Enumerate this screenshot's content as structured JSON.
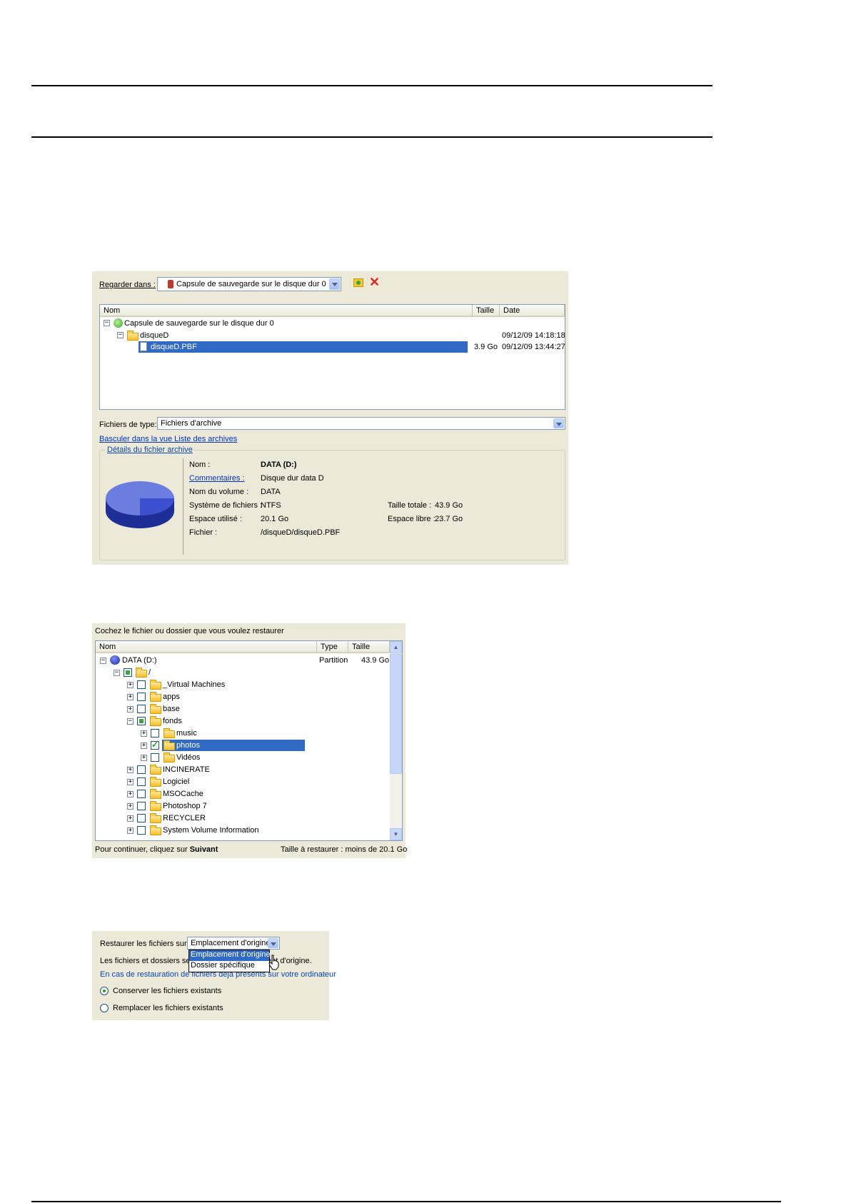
{
  "panel1": {
    "look_in_label": "Regarder dans :",
    "look_in_value": "Capsule de sauvegarde sur le disque dur 0",
    "columns": [
      "Nom",
      "Taille",
      "Date"
    ],
    "rows": [
      {
        "name": "Capsule de sauvegarde sur le disque dur 0",
        "size": "",
        "date": ""
      },
      {
        "name": "disqueD",
        "size": "",
        "date": "09/12/09 14:18:18"
      },
      {
        "name": "disqueD.PBF",
        "size": "3.9 Go",
        "date": "09/12/09 13:44:27"
      }
    ],
    "file_type_label": "Fichiers de type:",
    "file_type_value": "Fichiers d'archive",
    "switch_link": "Basculer dans la vue Liste des archives",
    "details_legend": "Détails du fichier archive",
    "details": {
      "nom_label": "Nom :",
      "nom_value": "DATA (D:)",
      "comment_label": "Commentaires :",
      "comment_value": "Disque dur data D",
      "volume_label": "Nom du volume :",
      "volume_value": "DATA",
      "fs_label": "Système de fichiers :",
      "fs_value": "NTFS",
      "used_label": "Espace utilisé :",
      "used_value": "20.1 Go",
      "file_label": "Fichier :",
      "file_value": "/disqueD/disqueD.PBF",
      "total_label": "Taille totale :",
      "total_value": "43.9 Go",
      "free_label": "Espace libre :",
      "free_value": "23.7 Go"
    }
  },
  "panel2": {
    "instruction": "Cochez le fichier ou dossier que vous voulez restaurer",
    "columns": [
      "Nom",
      "Type",
      "Taille"
    ],
    "root": {
      "name": "DATA (D:)",
      "type": "Partition",
      "size": "43.9 Go"
    },
    "slash": "/",
    "items": [
      "_Virtual Machines",
      "apps",
      "base",
      "fonds",
      "music",
      "photos",
      "Vidéos",
      "INCINERATE",
      "Logiciel",
      "MSOCache",
      "Photoshop 7",
      "RECYCLER",
      "System Volume Information"
    ],
    "footer_left": "Pour continuer, cliquez sur",
    "footer_bold": "Suivant",
    "footer_right": "Taille à restaurer : moins de 20.1 Go"
  },
  "panel3": {
    "restore_label": "Restaurer les fichiers sur :",
    "restore_value": "Emplacement d'origine",
    "options": [
      "Emplacement d'origine",
      "Dossier spécifique"
    ],
    "info_prefix": "Les fichiers et dossiers sero",
    "info_suffix": "ent d'origine.",
    "existing_legend": "En cas de restauration de fichiers déjà présents sur votre ordinateur",
    "radio_keep": "Conserver les fichiers existants",
    "radio_replace": "Remplacer les fichiers existants"
  }
}
